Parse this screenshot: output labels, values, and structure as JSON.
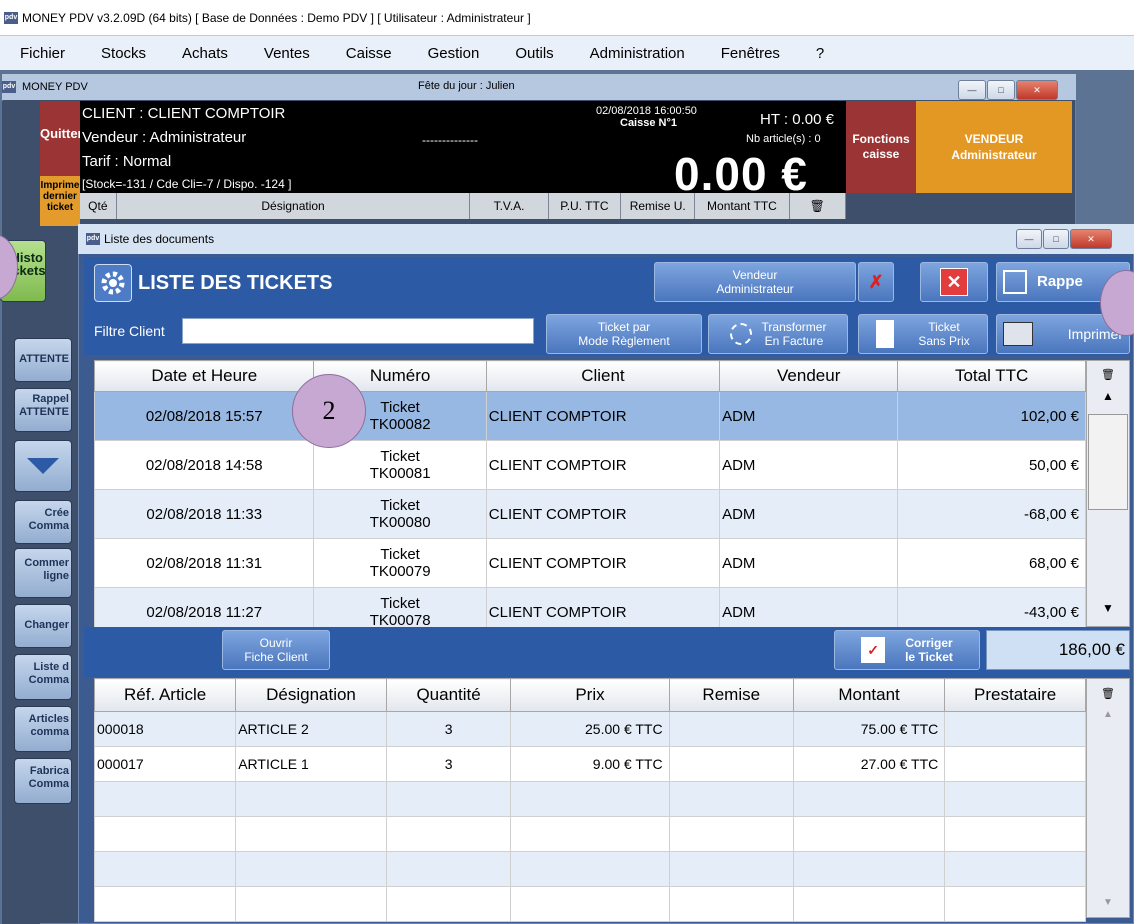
{
  "app": {
    "title": "MONEY PDV v3.2.09D (64 bits) [ Base de Données : Demo PDV ] [ Utilisateur : Administrateur ]",
    "logo": "pdv"
  },
  "menu": [
    "Fichier",
    "Stocks",
    "Achats",
    "Ventes",
    "Caisse",
    "Gestion",
    "Outils",
    "Administration",
    "Fenêtres",
    "?"
  ],
  "pos_window": {
    "title": "MONEY PDV",
    "fete": "Fête du jour : Julien"
  },
  "header": {
    "quit": "Quitter",
    "client": "CLIENT : CLIENT COMPTOIR",
    "vendeur": "Vendeur : Administrateur",
    "tarif": "Tarif : Normal",
    "stock": "[Stock=-131 / Cde Cli=-7 / Dispo. -124 ]",
    "dashes": "--------------",
    "datetime": "02/08/2018 16:00:50",
    "caisse": "Caisse N°1",
    "ht": "HT : 0.00 €",
    "nb_articles": "Nb article(s) : 0",
    "total": "0.00 €",
    "fonctions_l1": "Fonctions",
    "fonctions_l2": "caisse",
    "vendeur_box_l1": "VENDEUR",
    "vendeur_box_l2": "Administrateur",
    "imprime_l1": "Imprime",
    "imprime_l2": "dernier",
    "imprime_l3": "ticket"
  },
  "cart_columns": [
    "Qté",
    "Désignation",
    "T.V.A.",
    "P.U. TTC",
    "Remise U.",
    "Montant TTC"
  ],
  "sidebar": {
    "histo_l1": "Histo",
    "histo_l2": "Tickets",
    "attente": "ATTENTE",
    "rappel_l1": "Rappel",
    "rappel_l2": "ATTENTE",
    "cree_l1": "Crée",
    "cree_l2": "Comma",
    "commentaire_l1": "Commer",
    "commentaire_l2": "ligne",
    "changer": "Changer",
    "liste_l1": "Liste d",
    "liste_l2": "Comma",
    "articles_l1": "Articles",
    "articles_l2": "comma",
    "fabrica_l1": "Fabrica",
    "fabrica_l2": "Comma"
  },
  "dialog": {
    "title": "Liste des documents",
    "heading": "LISTE DES TICKETS",
    "vendeur_btn_l1": "Vendeur",
    "vendeur_btn_l2": "Administrateur",
    "rappel_btn": "Rappe",
    "filtre_label": "Filtre Client",
    "filtre_value": "",
    "ticket_mode_l1": "Ticket par",
    "ticket_mode_l2": "Mode Règlement",
    "transformer_l1": "Transformer",
    "transformer_l2": "En Facture",
    "sans_prix_l1": "Ticket",
    "sans_prix_l2": "Sans Prix",
    "imprimer": "Imprimer",
    "ouvrir_l1": "Ouvrir",
    "ouvrir_l2": "Fiche Client",
    "corriger_l1": "Corriger",
    "corriger_l2": "le Ticket",
    "total": "186,00 €"
  },
  "tickets": {
    "columns": [
      "Date et Heure",
      "Numéro",
      "Client",
      "Vendeur",
      "Total TTC"
    ],
    "rows": [
      {
        "date": "02/08/2018 15:57",
        "num1": "Ticket",
        "num2": "TK00082",
        "client": "CLIENT COMPTOIR",
        "vendeur": "ADM",
        "total": "102,00 €"
      },
      {
        "date": "02/08/2018 14:58",
        "num1": "Ticket",
        "num2": "TK00081",
        "client": "CLIENT COMPTOIR",
        "vendeur": "ADM",
        "total": "50,00 €"
      },
      {
        "date": "02/08/2018 11:33",
        "num1": "Ticket",
        "num2": "TK00080",
        "client": "CLIENT COMPTOIR",
        "vendeur": "ADM",
        "total": "-68,00 €"
      },
      {
        "date": "02/08/2018 11:31",
        "num1": "Ticket",
        "num2": "TK00079",
        "client": "CLIENT COMPTOIR",
        "vendeur": "ADM",
        "total": "68,00 €"
      },
      {
        "date": "02/08/2018 11:27",
        "num1": "Ticket",
        "num2": "TK00078",
        "client": "CLIENT COMPTOIR",
        "vendeur": "ADM",
        "total": "-43,00 €"
      }
    ]
  },
  "lines": {
    "columns": [
      "Réf. Article",
      "Désignation",
      "Quantité",
      "Prix",
      "Remise",
      "Montant",
      "Prestataire"
    ],
    "rows": [
      {
        "ref": "000018",
        "designation": "ARTICLE 2",
        "qte": "3",
        "prix": "25.00 € TTC",
        "remise": "",
        "montant": "75.00 € TTC",
        "prestataire": ""
      },
      {
        "ref": "000017",
        "designation": "ARTICLE 1",
        "qte": "3",
        "prix": "9.00 € TTC",
        "remise": "",
        "montant": "27.00 € TTC",
        "prestataire": ""
      }
    ]
  },
  "callouts": {
    "c2": "2"
  },
  "colors": {
    "accent": "#2d5aa4",
    "selected": "#97b8e2",
    "alt_row": "#e5eef8",
    "orange": "#e49824",
    "red": "#9b3434"
  },
  "icons": [
    "gear-icon",
    "x-red-icon",
    "close-box-icon",
    "edit-icon",
    "transform-icon",
    "document-icon",
    "printer-icon",
    "abc-check-icon",
    "trash-icon",
    "chevron-down-icon",
    "scroll-up-icon",
    "scroll-down-icon"
  ]
}
